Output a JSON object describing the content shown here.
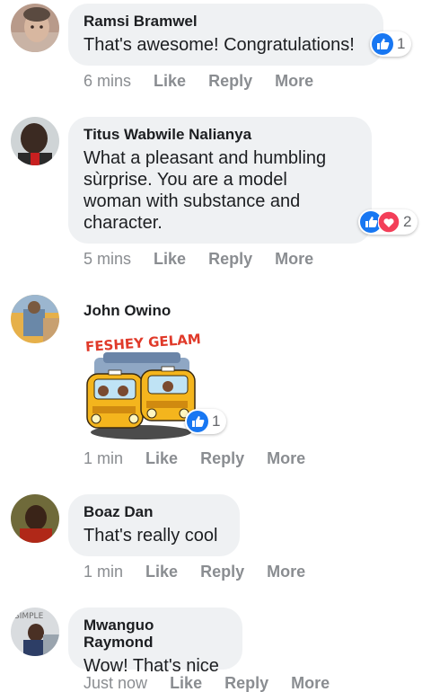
{
  "comments": [
    {
      "author": "Ramsi Bramwel",
      "text": "That's awesome! Congratulations!",
      "time": "6 mins",
      "reaction_count": "1",
      "like_label": "Like",
      "reply_label": "Reply",
      "more_label": "More"
    },
    {
      "author": "Titus Wabwile Nalianya",
      "text_lines": [
        "What a pleasant and humbling",
        "sùrprise. You are a model",
        "woman with substance and",
        "character."
      ],
      "time": "5 mins",
      "reaction_count": "2",
      "like_label": "Like",
      "reply_label": "Reply",
      "more_label": "More"
    },
    {
      "author": "John Owino",
      "sticker_text": "FESHEY GELAM!",
      "time": "1 min",
      "reaction_count": "1",
      "like_label": "Like",
      "reply_label": "Reply",
      "more_label": "More"
    },
    {
      "author": "Boaz Dan",
      "text": "That's really cool",
      "time": "1 min",
      "like_label": "Like",
      "reply_label": "Reply",
      "more_label": "More"
    },
    {
      "author": "Mwanguo Raymond",
      "text": "Wow! That's nice",
      "avatar_text": "SIMPLE",
      "time": "Just now",
      "like_label": "Like",
      "reply_label": "Reply",
      "more_label": "More"
    }
  ],
  "colors": {
    "like_blue": "#1877f2",
    "love_red": "#f33e58",
    "bubble_bg": "#eff1f3",
    "meta_gray": "#8a8d91"
  },
  "icons": {
    "like": "thumbs-up-icon",
    "love": "heart-icon"
  }
}
